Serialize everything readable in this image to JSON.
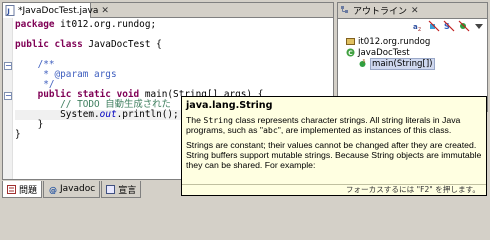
{
  "editor": {
    "tab_label": "*JavaDocTest.java",
    "tab_close": "✕",
    "lines": [
      {
        "parts": [
          {
            "t": "package ",
            "c": "kw"
          },
          {
            "t": "it012.org.rundog;",
            "c": ""
          }
        ]
      },
      {
        "parts": []
      },
      {
        "parts": [
          {
            "t": "public class ",
            "c": "kw"
          },
          {
            "t": "JavaDocTest {",
            "c": ""
          }
        ]
      },
      {
        "parts": []
      },
      {
        "parts": [
          {
            "t": "    /**",
            "c": "jd"
          }
        ]
      },
      {
        "parts": [
          {
            "t": "     * @param args",
            "c": "jd"
          }
        ]
      },
      {
        "parts": [
          {
            "t": "     */",
            "c": "jd"
          }
        ]
      },
      {
        "parts": [
          {
            "t": "    public static void ",
            "c": "kw"
          },
          {
            "t": "main(String[] args) {",
            "c": ""
          }
        ]
      },
      {
        "parts": [
          {
            "t": "        // TODO 自動生成された",
            "c": "cm"
          }
        ]
      },
      {
        "parts": [
          {
            "t": "        System.",
            "c": ""
          },
          {
            "t": "out",
            "c": "fld"
          },
          {
            "t": ".println();",
            "c": ""
          }
        ]
      },
      {
        "parts": [
          {
            "t": "    }",
            "c": ""
          }
        ]
      },
      {
        "parts": [
          {
            "t": "}",
            "c": ""
          }
        ]
      }
    ]
  },
  "outline": {
    "title": "アウトライン",
    "close": "✕",
    "toolbar": [
      "sort-icon",
      "hide-fields-icon",
      "hide-static-icon",
      "hide-nonpublic-icon",
      "menu-icon"
    ],
    "tree": [
      {
        "label": "it012.org.rundog",
        "icon": "package-icon",
        "indent": 0,
        "selected": false
      },
      {
        "label": "JavaDocTest",
        "icon": "class-icon",
        "indent": 0,
        "selected": false
      },
      {
        "label": "main(String[])",
        "icon": "method-icon",
        "indent": 12,
        "selected": true
      }
    ]
  },
  "bottom_tabs": [
    {
      "label": "問題",
      "icon": "problems-icon",
      "active": true
    },
    {
      "label": "Javadoc",
      "icon": "javadoc-icon",
      "active": false
    },
    {
      "label": "宣言",
      "icon": "declaration-icon",
      "active": false
    }
  ],
  "popup": {
    "title": "java.lang.String",
    "p1_a": "The ",
    "p1_code1": "String",
    "p1_b": " class represents character strings. All string literals in Java programs, such as \"",
    "p1_code2": "abc",
    "p1_c": "\", are implemented as instances of this class.",
    "p2": "Strings are constant; their values cannot be changed after they are created. String buffers support mutable strings. Because String objects are immutable they can be shared. For example:",
    "footer": "フォーカスするには \"F2\" を押します。"
  },
  "colors": {
    "keyword": "#7f0055",
    "comment": "#3f7f5f",
    "javadoc": "#3f5fbf",
    "popup_bg": "#ffffe1"
  }
}
